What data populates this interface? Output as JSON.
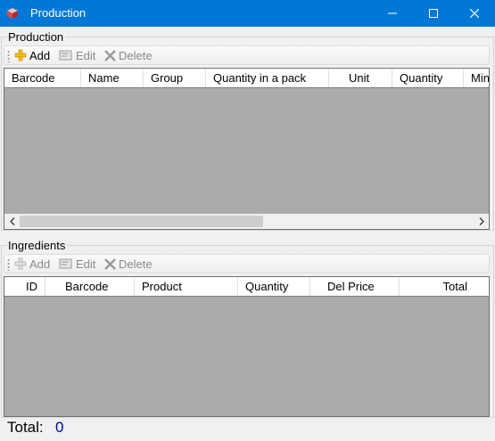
{
  "window": {
    "title": "Production",
    "icons": {
      "app": "box-icon",
      "minimize": "minimize-icon",
      "maximize": "maximize-icon",
      "close": "close-icon"
    }
  },
  "production": {
    "group_label": "Production",
    "toolbar": {
      "add": {
        "label": "Add",
        "icon": "add-icon",
        "enabled": true
      },
      "edit": {
        "label": "Edit",
        "icon": "edit-icon",
        "enabled": false
      },
      "delete": {
        "label": "Delete",
        "icon": "delete-icon",
        "enabled": false
      }
    },
    "columns": [
      "Barcode",
      "Name",
      "Group",
      "Quantity in a pack",
      "Unit",
      "Quantity",
      "Min"
    ],
    "rows": []
  },
  "ingredients": {
    "group_label": "Ingredients",
    "toolbar": {
      "add": {
        "label": "Add",
        "icon": "add-icon",
        "enabled": false
      },
      "edit": {
        "label": "Edit",
        "icon": "edit-icon",
        "enabled": false
      },
      "delete": {
        "label": "Delete",
        "icon": "delete-icon",
        "enabled": false
      }
    },
    "columns": [
      "ID",
      "Barcode",
      "Product",
      "Quantity",
      "Del Price",
      "Total"
    ],
    "rows": []
  },
  "footer": {
    "total_label": "Total:",
    "total_value": "0"
  },
  "colors": {
    "titlebar": "#0078d7",
    "grid_background": "#ababab",
    "total_value": "#0000c8"
  }
}
